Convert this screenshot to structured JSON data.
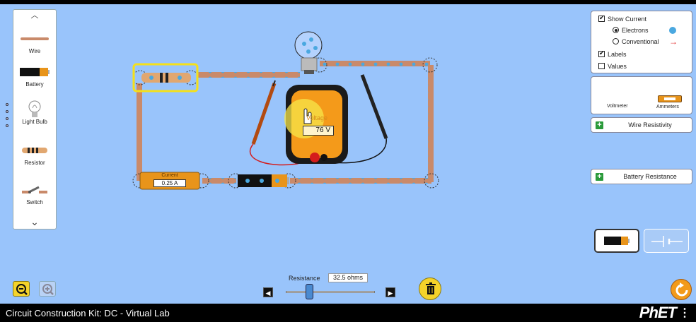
{
  "toolbox": {
    "up_arrow": "︿",
    "down_arrow": "⌄",
    "items": [
      {
        "label": "Wire",
        "icon": "wire-icon"
      },
      {
        "label": "Battery",
        "icon": "battery-icon"
      },
      {
        "label": "Light Bulb",
        "icon": "light-bulb-icon"
      },
      {
        "label": "Resistor",
        "icon": "resistor-icon"
      },
      {
        "label": "Switch",
        "icon": "switch-icon"
      }
    ]
  },
  "circuit": {
    "ammeter_title": "Current",
    "ammeter_value": "0.25 A",
    "voltmeter_title": "Voltage",
    "voltmeter_value": "76 V"
  },
  "controls": {
    "show_current": {
      "label": "Show Current",
      "checked": true
    },
    "electrons": {
      "label": "Electrons",
      "selected": true
    },
    "conventional": {
      "label": "Conventional",
      "selected": false
    },
    "labels": {
      "label": "Labels",
      "checked": true
    },
    "values": {
      "label": "Values",
      "checked": false
    }
  },
  "sensors": {
    "voltmeter_label": "Voltmeter",
    "ammeters_label": "Ammeters"
  },
  "accordions": {
    "wire_resistivity": "Wire Resistivity",
    "battery_resistance": "Battery Resistance"
  },
  "resistance": {
    "label": "Resistance",
    "value": "32.5 ohms",
    "left_arrow": "◀",
    "right_arrow": "▶"
  },
  "bottom": {
    "title": "Circuit Construction Kit: DC - Virtual Lab",
    "logo": "PhET",
    "menu": "⋮"
  },
  "colors": {
    "background": "#99c4fb",
    "accent_yellow": "#f5d32a",
    "wire_copper": "#c98a6a",
    "electron_blue": "#4aa8e0",
    "meter_orange": "#f49a1a"
  }
}
